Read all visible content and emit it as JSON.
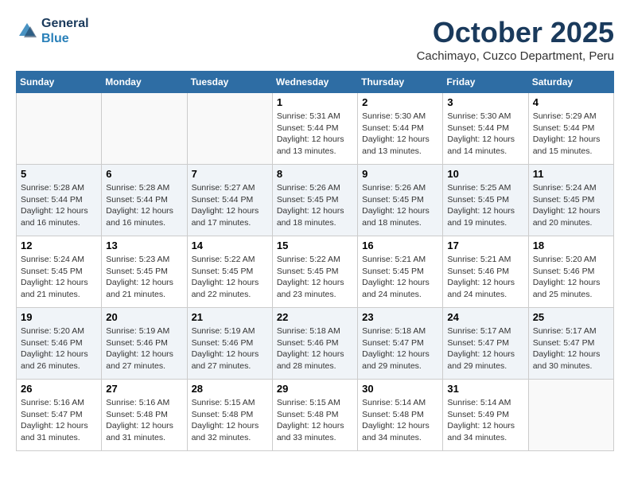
{
  "header": {
    "logo_line1": "General",
    "logo_line2": "Blue",
    "month": "October 2025",
    "location": "Cachimayo, Cuzco Department, Peru"
  },
  "days_of_week": [
    "Sunday",
    "Monday",
    "Tuesday",
    "Wednesday",
    "Thursday",
    "Friday",
    "Saturday"
  ],
  "weeks": [
    [
      {
        "day": "",
        "info": ""
      },
      {
        "day": "",
        "info": ""
      },
      {
        "day": "",
        "info": ""
      },
      {
        "day": "1",
        "info": "Sunrise: 5:31 AM\nSunset: 5:44 PM\nDaylight: 12 hours\nand 13 minutes."
      },
      {
        "day": "2",
        "info": "Sunrise: 5:30 AM\nSunset: 5:44 PM\nDaylight: 12 hours\nand 13 minutes."
      },
      {
        "day": "3",
        "info": "Sunrise: 5:30 AM\nSunset: 5:44 PM\nDaylight: 12 hours\nand 14 minutes."
      },
      {
        "day": "4",
        "info": "Sunrise: 5:29 AM\nSunset: 5:44 PM\nDaylight: 12 hours\nand 15 minutes."
      }
    ],
    [
      {
        "day": "5",
        "info": "Sunrise: 5:28 AM\nSunset: 5:44 PM\nDaylight: 12 hours\nand 16 minutes."
      },
      {
        "day": "6",
        "info": "Sunrise: 5:28 AM\nSunset: 5:44 PM\nDaylight: 12 hours\nand 16 minutes."
      },
      {
        "day": "7",
        "info": "Sunrise: 5:27 AM\nSunset: 5:44 PM\nDaylight: 12 hours\nand 17 minutes."
      },
      {
        "day": "8",
        "info": "Sunrise: 5:26 AM\nSunset: 5:45 PM\nDaylight: 12 hours\nand 18 minutes."
      },
      {
        "day": "9",
        "info": "Sunrise: 5:26 AM\nSunset: 5:45 PM\nDaylight: 12 hours\nand 18 minutes."
      },
      {
        "day": "10",
        "info": "Sunrise: 5:25 AM\nSunset: 5:45 PM\nDaylight: 12 hours\nand 19 minutes."
      },
      {
        "day": "11",
        "info": "Sunrise: 5:24 AM\nSunset: 5:45 PM\nDaylight: 12 hours\nand 20 minutes."
      }
    ],
    [
      {
        "day": "12",
        "info": "Sunrise: 5:24 AM\nSunset: 5:45 PM\nDaylight: 12 hours\nand 21 minutes."
      },
      {
        "day": "13",
        "info": "Sunrise: 5:23 AM\nSunset: 5:45 PM\nDaylight: 12 hours\nand 21 minutes."
      },
      {
        "day": "14",
        "info": "Sunrise: 5:22 AM\nSunset: 5:45 PM\nDaylight: 12 hours\nand 22 minutes."
      },
      {
        "day": "15",
        "info": "Sunrise: 5:22 AM\nSunset: 5:45 PM\nDaylight: 12 hours\nand 23 minutes."
      },
      {
        "day": "16",
        "info": "Sunrise: 5:21 AM\nSunset: 5:45 PM\nDaylight: 12 hours\nand 24 minutes."
      },
      {
        "day": "17",
        "info": "Sunrise: 5:21 AM\nSunset: 5:46 PM\nDaylight: 12 hours\nand 24 minutes."
      },
      {
        "day": "18",
        "info": "Sunrise: 5:20 AM\nSunset: 5:46 PM\nDaylight: 12 hours\nand 25 minutes."
      }
    ],
    [
      {
        "day": "19",
        "info": "Sunrise: 5:20 AM\nSunset: 5:46 PM\nDaylight: 12 hours\nand 26 minutes."
      },
      {
        "day": "20",
        "info": "Sunrise: 5:19 AM\nSunset: 5:46 PM\nDaylight: 12 hours\nand 27 minutes."
      },
      {
        "day": "21",
        "info": "Sunrise: 5:19 AM\nSunset: 5:46 PM\nDaylight: 12 hours\nand 27 minutes."
      },
      {
        "day": "22",
        "info": "Sunrise: 5:18 AM\nSunset: 5:46 PM\nDaylight: 12 hours\nand 28 minutes."
      },
      {
        "day": "23",
        "info": "Sunrise: 5:18 AM\nSunset: 5:47 PM\nDaylight: 12 hours\nand 29 minutes."
      },
      {
        "day": "24",
        "info": "Sunrise: 5:17 AM\nSunset: 5:47 PM\nDaylight: 12 hours\nand 29 minutes."
      },
      {
        "day": "25",
        "info": "Sunrise: 5:17 AM\nSunset: 5:47 PM\nDaylight: 12 hours\nand 30 minutes."
      }
    ],
    [
      {
        "day": "26",
        "info": "Sunrise: 5:16 AM\nSunset: 5:47 PM\nDaylight: 12 hours\nand 31 minutes."
      },
      {
        "day": "27",
        "info": "Sunrise: 5:16 AM\nSunset: 5:48 PM\nDaylight: 12 hours\nand 31 minutes."
      },
      {
        "day": "28",
        "info": "Sunrise: 5:15 AM\nSunset: 5:48 PM\nDaylight: 12 hours\nand 32 minutes."
      },
      {
        "day": "29",
        "info": "Sunrise: 5:15 AM\nSunset: 5:48 PM\nDaylight: 12 hours\nand 33 minutes."
      },
      {
        "day": "30",
        "info": "Sunrise: 5:14 AM\nSunset: 5:48 PM\nDaylight: 12 hours\nand 34 minutes."
      },
      {
        "day": "31",
        "info": "Sunrise: 5:14 AM\nSunset: 5:49 PM\nDaylight: 12 hours\nand 34 minutes."
      },
      {
        "day": "",
        "info": ""
      }
    ]
  ]
}
